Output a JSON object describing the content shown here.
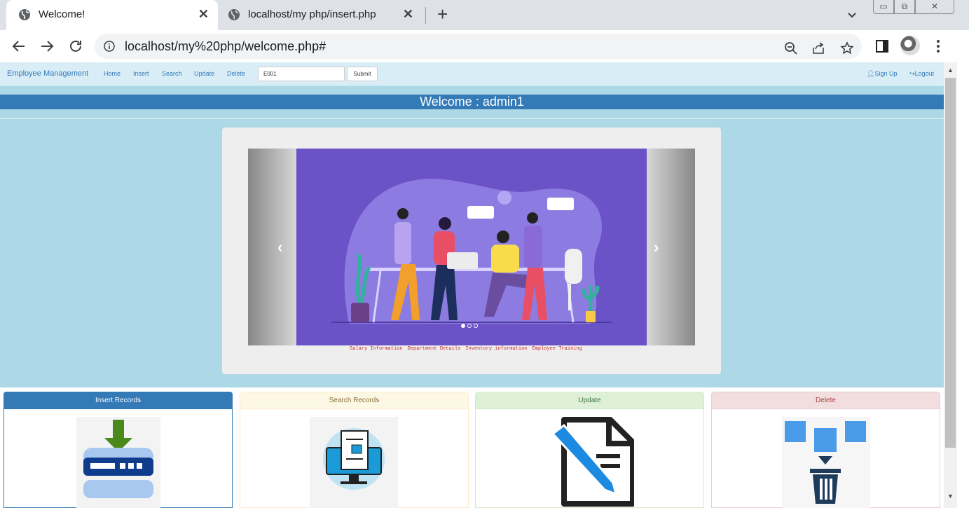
{
  "browser": {
    "tabs": [
      {
        "title": "Welcome!",
        "active": true
      },
      {
        "title": "localhost/my php/insert.php",
        "active": false
      }
    ],
    "url": "localhost/my%20php/welcome.php#"
  },
  "navbar": {
    "brand": "Employee Management",
    "links": [
      "Home",
      "Insert",
      "Search",
      "Update",
      "Delete"
    ],
    "search_value": "E001",
    "submit_label": "Submit",
    "signup_label": "Sign Up",
    "logout_label": "Logout"
  },
  "welcome": "Welcome : admin1",
  "carousel": {
    "captions": [
      "Salary Information",
      "Department Details",
      "Inventory information",
      "Employee Training"
    ]
  },
  "cards": [
    {
      "title": "Insert Records"
    },
    {
      "title": "Search Records"
    },
    {
      "title": "Update"
    },
    {
      "title": "Delete"
    }
  ],
  "colors": {
    "page_bg": "#add8e6",
    "primary": "#337ab7",
    "carousel_bg": "#6a53c6"
  }
}
